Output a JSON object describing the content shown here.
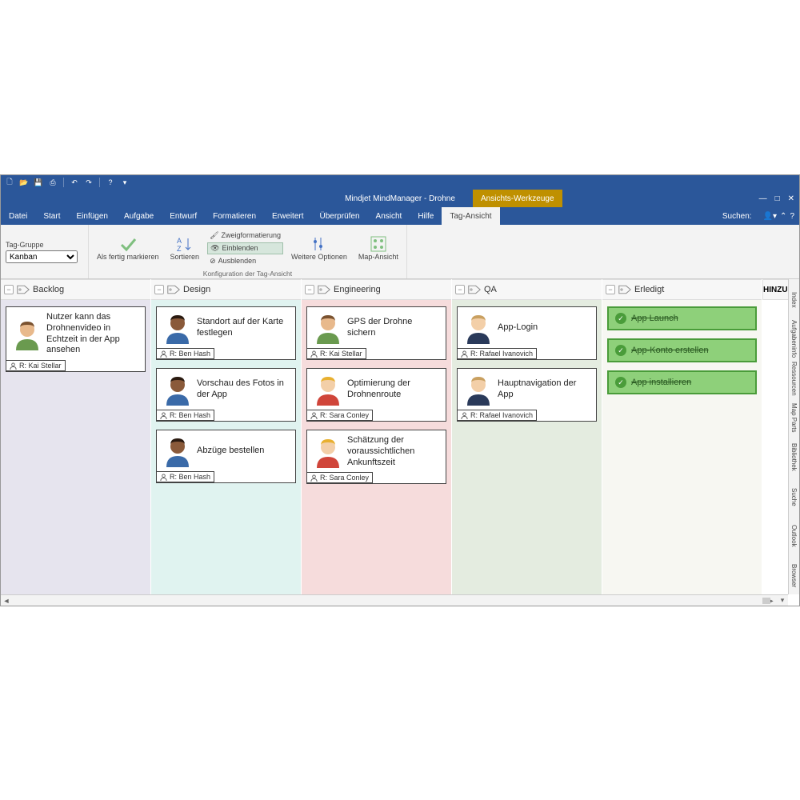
{
  "window": {
    "title": "Mindjet MindManager - Drohne",
    "context_tab": "Ansichts-Werkzeuge",
    "search_label": "Suchen:"
  },
  "menu": [
    "Datei",
    "Start",
    "Einfügen",
    "Aufgabe",
    "Entwurf",
    "Formatieren",
    "Erweitert",
    "Überprüfen",
    "Ansicht",
    "Hilfe",
    "Tag-Ansicht"
  ],
  "ribbon": {
    "taggroup_label": "Tag-Gruppe",
    "taggroup_value": "Kanban",
    "mark_done": "Als fertig markieren",
    "sort": "Sortieren",
    "branchfmt": "Zweigformatierung",
    "show": "Einblenden",
    "hide": "Ausblenden",
    "moreopts": "Weitere Optionen",
    "mapview": "Map-Ansicht",
    "group_caption": "Konfiguration der Tag-Ansicht"
  },
  "board": {
    "add_label": "HINZU",
    "columns": [
      {
        "id": "backlog",
        "label": "Backlog",
        "cards": [
          {
            "title": "Nutzer kann das Drohnenvideo in Echtzeit in der App ansehen",
            "assignee": "R: Kai Stellar",
            "avatar": "m-tan-green"
          }
        ]
      },
      {
        "id": "design",
        "label": "Design",
        "cards": [
          {
            "title": "Standort auf der Karte festlegen",
            "assignee": "R: Ben Hash",
            "avatar": "m-dark-blue"
          },
          {
            "title": "Vorschau des Fotos in der App",
            "assignee": "R: Ben Hash",
            "avatar": "m-dark-blue"
          },
          {
            "title": "Abzüge bestellen",
            "assignee": "R: Ben Hash",
            "avatar": "m-dark-blue"
          }
        ]
      },
      {
        "id": "eng",
        "label": "Engineering",
        "cards": [
          {
            "title": "GPS der Drohne sichern",
            "assignee": "R: Kai Stellar",
            "avatar": "m-tan-green"
          },
          {
            "title": "Optimierung der Drohnenroute",
            "assignee": "R: Sara Conley",
            "avatar": "f-light-red"
          },
          {
            "title": "Schätzung der voraussichtlichen Ankunftszeit",
            "assignee": "R: Sara Conley",
            "avatar": "f-light-red"
          }
        ]
      },
      {
        "id": "qa",
        "label": "QA",
        "cards": [
          {
            "title": "App-Login",
            "assignee": "R: Rafael Ivanovich",
            "avatar": "m-light-navy"
          },
          {
            "title": "Hauptnavigation der App",
            "assignee": "R: Rafael Ivanovich",
            "avatar": "m-light-navy"
          }
        ]
      },
      {
        "id": "done",
        "label": "Erledigt",
        "done_cards": [
          {
            "title": "App Launch"
          },
          {
            "title": "App-Konto erstellen"
          },
          {
            "title": "App installieren"
          }
        ]
      }
    ]
  },
  "sidetabs": [
    "Index",
    "Aufgabeninfo",
    "Ressourcen",
    "Map Parts",
    "Bibliothek",
    "Suche",
    "Outlook",
    "Browser"
  ]
}
